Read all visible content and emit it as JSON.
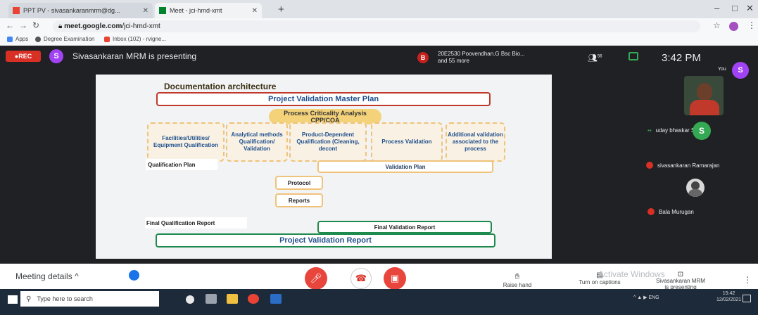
{
  "browser": {
    "tabs": [
      {
        "label": "PPT PV - sivasankaranmrm@dg...",
        "color": "#ea4335"
      },
      {
        "label": "Meet - jci-hmd-xmt",
        "color": "#00832d"
      }
    ],
    "url_host": "meet.google.com",
    "url_path": "/jci-hmd-xmt",
    "bookmarks": [
      {
        "label": "Apps",
        "color": "#4285f4"
      },
      {
        "label": "Degree Examination",
        "color": "#555555"
      },
      {
        "label": "Inbox (102) - rvigne...",
        "color": "#ea4335"
      }
    ]
  },
  "meet": {
    "rec_label": "REC",
    "presenter_initial": "S",
    "presenting_text": "Sivasankaran MRM is presenting",
    "notif_initial": "B",
    "notif_line1": "20E2530 Poovendhan.G Bsc Bio...",
    "notif_line2": "and 55 more",
    "people_count": "56",
    "clock": "3:42 PM",
    "you_label": "You",
    "you_initial": "S",
    "participants": [
      {
        "name": "uday bhaskar Suram"
      },
      {
        "name": "sivasankaran Ramarajan",
        "initial": "S"
      },
      {
        "name": "Bala Murugan"
      }
    ]
  },
  "slide": {
    "title": "Documentation architecture",
    "master_plan": "Project Validation Master Plan",
    "criticality_line1": "Process Criticality Analysis",
    "criticality_line2": "CPP/CQA",
    "categories": [
      "Facilities/Utilities/ Equipment Qualification",
      "Analytical methods Qualification/ Validation",
      "Product-Dependent Qualification (Cleaning, decont",
      "Process Validation",
      "Additional validation associated to the process"
    ],
    "qualification_plan": "Qualification Plan",
    "validation_plan": "Validation Plan",
    "protocol": "Protocol",
    "reports": "Reports",
    "final_qualification_report": "Final Qualification Report",
    "final_validation_report": "Final Validation Report",
    "project_validation_report": "Project Validation Report"
  },
  "bottom": {
    "meeting_details": "Meeting details",
    "raise_hand": "Raise hand",
    "turn_on_captions": "Turn on captions",
    "activate_windows": "Activate Windows",
    "presenting_line1": "Sivasankaran MRM",
    "presenting_line2": "is presenting"
  },
  "taskbar": {
    "search_placeholder": "Type here to search",
    "lang": "ENG",
    "time": "15:42",
    "date": "12/02/2021"
  }
}
